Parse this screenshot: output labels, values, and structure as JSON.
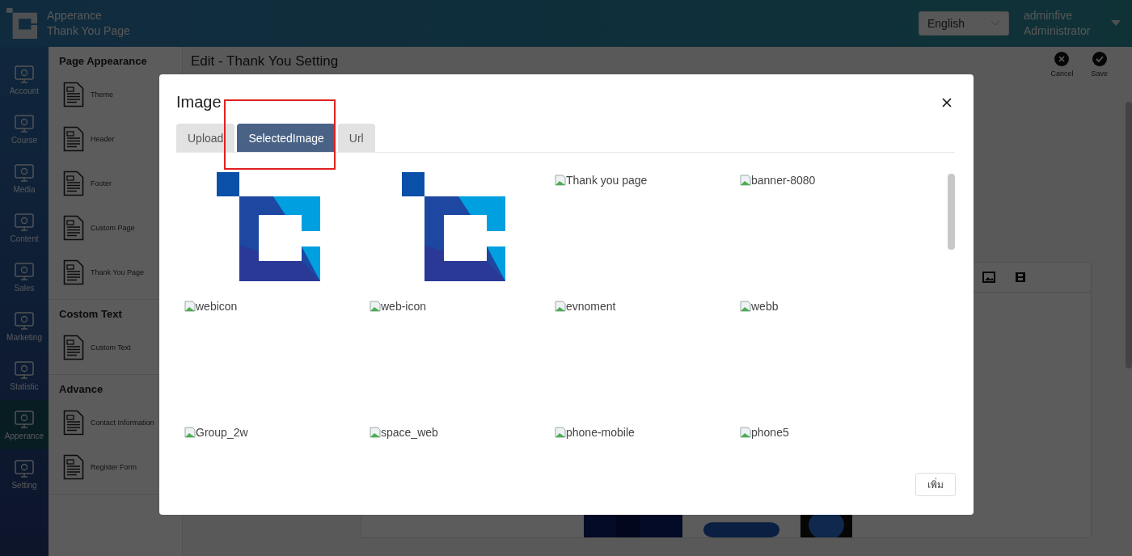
{
  "header": {
    "section": "Apperance",
    "page": "Thank You Page",
    "language": "English",
    "user": "adminfive",
    "role": "Administrator"
  },
  "nav": [
    {
      "label": "Account",
      "selected": false
    },
    {
      "label": "Course",
      "selected": false
    },
    {
      "label": "Media",
      "selected": false
    },
    {
      "label": "Content",
      "selected": false
    },
    {
      "label": "Sales",
      "selected": false
    },
    {
      "label": "Marketing",
      "selected": false
    },
    {
      "label": "Statistic",
      "selected": false
    },
    {
      "label": "Apperance",
      "selected": true
    },
    {
      "label": "Setting",
      "selected": false
    }
  ],
  "sidebar": [
    {
      "title": "Page Appearance",
      "items": [
        "Theme",
        "Header",
        "Footer",
        "Custom Page",
        "Thank You Page"
      ]
    },
    {
      "title": "Costom Text",
      "items": [
        "Custom Text"
      ]
    },
    {
      "title": "Advance",
      "items": [
        "Contact Information",
        "Register Form"
      ]
    }
  ],
  "main": {
    "title": "Edit - Thank You Setting",
    "actions": [
      "Cancel",
      "Save"
    ]
  },
  "modal": {
    "title": "Image",
    "tabs": [
      {
        "label": "Upload",
        "selected": false
      },
      {
        "label": "SelectedImage",
        "selected": true
      },
      {
        "label": "Url",
        "selected": false
      }
    ],
    "images": [
      {
        "kind": "logo"
      },
      {
        "kind": "logo"
      },
      {
        "kind": "broken",
        "alt": "Thank you page"
      },
      {
        "kind": "broken",
        "alt": "banner-8080"
      },
      {
        "kind": "broken",
        "alt": "webicon"
      },
      {
        "kind": "broken",
        "alt": "web-icon"
      },
      {
        "kind": "broken",
        "alt": "evnoment"
      },
      {
        "kind": "broken",
        "alt": "webb"
      },
      {
        "kind": "broken",
        "alt": "Group_2w"
      },
      {
        "kind": "broken",
        "alt": "space_web"
      },
      {
        "kind": "broken",
        "alt": "phone-mobile"
      },
      {
        "kind": "broken",
        "alt": "phone5"
      }
    ],
    "add_button": "เพิ่ม"
  }
}
